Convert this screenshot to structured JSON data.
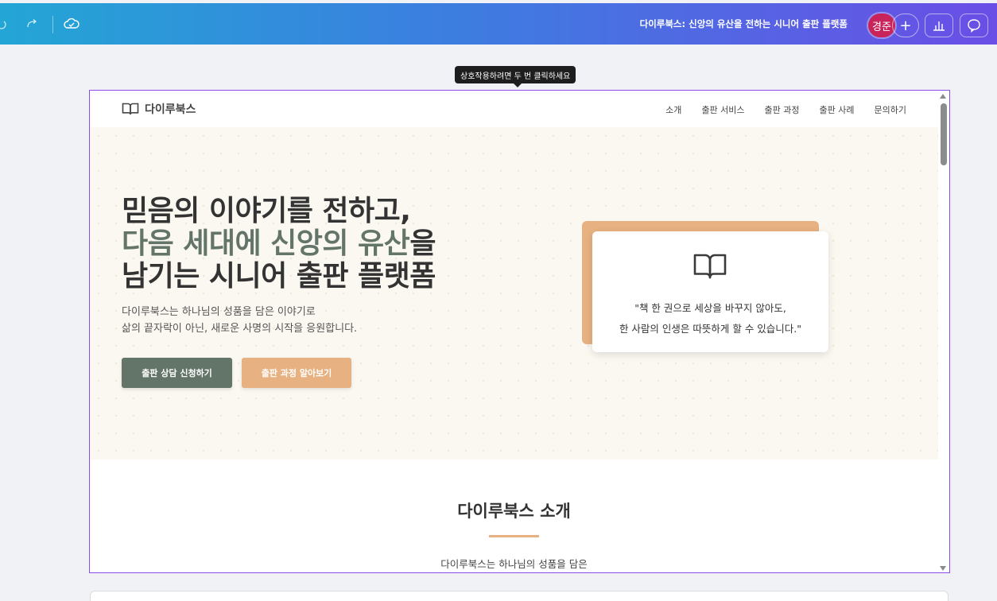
{
  "toolbar": {
    "doc_title": "다이루북스: 신앙의 유산을 전하는 시니어 출판 플랫폼",
    "avatar_initials": "경준",
    "plus_label": "+"
  },
  "tooltip": "상호작용하려면 두 번 클릭하세요",
  "site": {
    "logo_text": "다이루북스",
    "nav": [
      "소개",
      "출판 서비스",
      "출판 과정",
      "출판 사례",
      "문의하기"
    ],
    "hero": {
      "title_line1": "믿음의 이야기를 전하고,",
      "title_line2_accent": "다음 세대에 신앙의 유산",
      "title_line2_rest": "을",
      "title_line3": "남기는 시니어 출판 플랫폼",
      "desc_line1": "다이루북스는 하나님의 성품을 담은 이야기로",
      "desc_line2": "삶의 끝자락이 아닌, 새로운 사명의 시작을 응원합니다.",
      "primary_button": "출판 상담 신청하기",
      "secondary_button": "출판 과정 알아보기",
      "quote_line1": "\"책 한 권으로 세상을 바꾸지 않아도,",
      "quote_line2": "한 사람의 인생은 따뜻하게 할 수 있습니다.\""
    },
    "about": {
      "title": "다이루북스 소개",
      "text": "다이루북스는 하나님의 성품을 담은"
    }
  },
  "colors": {
    "accent_green": "#627568",
    "accent_orange": "#e7b181",
    "frame_border": "#8a4be8",
    "avatar_bg": "#c8245b"
  }
}
